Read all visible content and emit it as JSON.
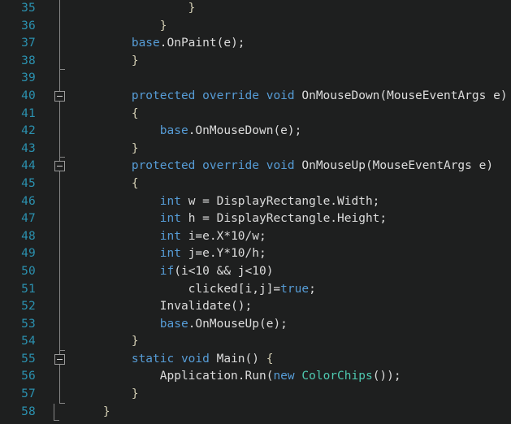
{
  "editor": {
    "name": "code-editor",
    "language": "C#",
    "background_color": "#1e1f1f",
    "line_number_color": "#2b91af",
    "keyword_color": "#569cd6",
    "type_color": "#4ec9b0",
    "text_color": "#dcdcdc",
    "brace_color": "#d4cfb4",
    "outline_guide_color": "#878787",
    "first_visible_line": 35,
    "last_visible_line": 58
  },
  "lines": [
    {
      "n": "35",
      "fold": "guide-full",
      "tokens": [
        {
          "t": "                }",
          "c": "br"
        }
      ]
    },
    {
      "n": "36",
      "fold": "guide-full",
      "tokens": [
        {
          "t": "            }",
          "c": "br"
        }
      ]
    },
    {
      "n": "37",
      "fold": "guide-full",
      "tokens": [
        {
          "t": "        ",
          "c": "pl"
        },
        {
          "t": "base",
          "c": "kw"
        },
        {
          "t": ".OnPaint(e);",
          "c": "pl"
        }
      ]
    },
    {
      "n": "38",
      "fold": "guide-end",
      "tokens": [
        {
          "t": "        }",
          "c": "br"
        }
      ]
    },
    {
      "n": "39",
      "fold": "guide-full",
      "tokens": [
        {
          "t": "",
          "c": "pl"
        }
      ]
    },
    {
      "n": "40",
      "fold": "box-collapse",
      "tokens": [
        {
          "t": "        ",
          "c": "pl"
        },
        {
          "t": "protected override void",
          "c": "kw"
        },
        {
          "t": " OnMouseDown(",
          "c": "pl"
        },
        {
          "t": "MouseEventArgs",
          "c": "pl"
        },
        {
          "t": " e)",
          "c": "pl"
        }
      ]
    },
    {
      "n": "41",
      "fold": "guide-full",
      "tokens": [
        {
          "t": "        {",
          "c": "br"
        }
      ]
    },
    {
      "n": "42",
      "fold": "guide-full",
      "tokens": [
        {
          "t": "            ",
          "c": "pl"
        },
        {
          "t": "base",
          "c": "kw"
        },
        {
          "t": ".OnMouseDown(e);",
          "c": "pl"
        }
      ]
    },
    {
      "n": "43",
      "fold": "guide-end",
      "tokens": [
        {
          "t": "        }",
          "c": "br"
        }
      ]
    },
    {
      "n": "44",
      "fold": "box-collapse",
      "tokens": [
        {
          "t": "        ",
          "c": "pl"
        },
        {
          "t": "protected override void",
          "c": "kw"
        },
        {
          "t": " OnMouseUp(",
          "c": "pl"
        },
        {
          "t": "MouseEventArgs",
          "c": "pl"
        },
        {
          "t": " e)",
          "c": "pl"
        }
      ]
    },
    {
      "n": "45",
      "fold": "guide-full",
      "tokens": [
        {
          "t": "        {",
          "c": "br"
        }
      ]
    },
    {
      "n": "46",
      "fold": "guide-full",
      "tokens": [
        {
          "t": "            ",
          "c": "pl"
        },
        {
          "t": "int",
          "c": "kw"
        },
        {
          "t": " w = DisplayRectangle.Width;",
          "c": "pl"
        }
      ]
    },
    {
      "n": "47",
      "fold": "guide-full",
      "tokens": [
        {
          "t": "            ",
          "c": "pl"
        },
        {
          "t": "int",
          "c": "kw"
        },
        {
          "t": " h = DisplayRectangle.Height;",
          "c": "pl"
        }
      ]
    },
    {
      "n": "48",
      "fold": "guide-full",
      "tokens": [
        {
          "t": "            ",
          "c": "pl"
        },
        {
          "t": "int",
          "c": "kw"
        },
        {
          "t": " i=e.X*10/w;",
          "c": "pl"
        }
      ]
    },
    {
      "n": "49",
      "fold": "guide-full",
      "tokens": [
        {
          "t": "            ",
          "c": "pl"
        },
        {
          "t": "int",
          "c": "kw"
        },
        {
          "t": " j=e.Y*10/h;",
          "c": "pl"
        }
      ]
    },
    {
      "n": "50",
      "fold": "guide-full",
      "tokens": [
        {
          "t": "            ",
          "c": "pl"
        },
        {
          "t": "if",
          "c": "ctrl"
        },
        {
          "t": "(i<10 && j<10)",
          "c": "pl"
        }
      ]
    },
    {
      "n": "51",
      "fold": "guide-full",
      "tokens": [
        {
          "t": "                clicked[i,j]=",
          "c": "pl"
        },
        {
          "t": "true",
          "c": "kw"
        },
        {
          "t": ";",
          "c": "pl"
        }
      ]
    },
    {
      "n": "52",
      "fold": "guide-full",
      "tokens": [
        {
          "t": "            Invalidate();",
          "c": "pl"
        }
      ]
    },
    {
      "n": "53",
      "fold": "guide-full",
      "tokens": [
        {
          "t": "            ",
          "c": "pl"
        },
        {
          "t": "base",
          "c": "kw"
        },
        {
          "t": ".OnMouseUp(e);",
          "c": "pl"
        }
      ]
    },
    {
      "n": "54",
      "fold": "guide-end",
      "tokens": [
        {
          "t": "        }",
          "c": "br"
        }
      ]
    },
    {
      "n": "55",
      "fold": "box-collapse",
      "tokens": [
        {
          "t": "        ",
          "c": "pl"
        },
        {
          "t": "static void",
          "c": "kw"
        },
        {
          "t": " Main() ",
          "c": "pl"
        },
        {
          "t": "{",
          "c": "br"
        }
      ]
    },
    {
      "n": "56",
      "fold": "guide-full",
      "tokens": [
        {
          "t": "            Application.Run(",
          "c": "pl"
        },
        {
          "t": "new",
          "c": "kw"
        },
        {
          "t": " ",
          "c": "pl"
        },
        {
          "t": "ColorChips",
          "c": "type"
        },
        {
          "t": "());",
          "c": "pl"
        }
      ]
    },
    {
      "n": "57",
      "fold": "guide-end",
      "tokens": [
        {
          "t": "        }",
          "c": "br"
        }
      ]
    },
    {
      "n": "58",
      "fold": "guide-outer-end",
      "tokens": [
        {
          "t": "    }",
          "c": "br"
        }
      ]
    }
  ]
}
